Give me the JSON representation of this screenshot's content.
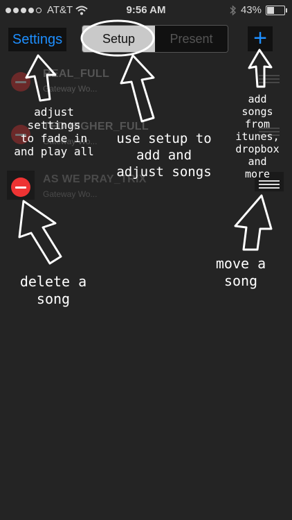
{
  "status_bar": {
    "carrier": "AT&T",
    "time": "9:56 AM",
    "battery": "43%",
    "battery_level": 0.43
  },
  "nav": {
    "settings_label": "Settings",
    "tabs": [
      {
        "label": "Setup",
        "selected": true
      },
      {
        "label": "Present",
        "selected": false
      }
    ],
    "add_label": "+"
  },
  "songs": [
    {
      "title": "REAL_FULL",
      "artist": "Gateway Wo..."
    },
    {
      "title": "TED HIGHER_FULL",
      "artist": "Gateway Wo..."
    },
    {
      "title": "AS WE PRAY_TRIX",
      "artist": "Gateway Wo..."
    }
  ],
  "annotations": {
    "settings": "adjust\nsettings\nto fade in\nand play all",
    "setup": "use setup to\nadd and\nadjust songs",
    "add": "add\nsongs\nfrom\nitunes,\ndropbox\nand\nmore",
    "delete": "delete a\nsong",
    "move": "move a\nsong"
  },
  "colors": {
    "background": "#242424",
    "accent": "#1e8fff",
    "delete": "#e33333"
  }
}
